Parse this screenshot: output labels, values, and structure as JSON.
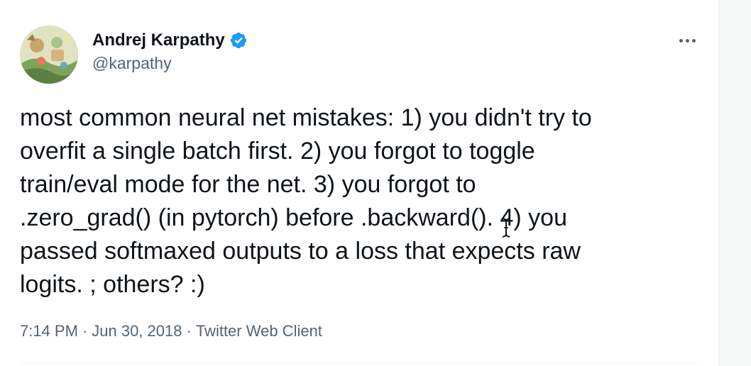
{
  "author": {
    "display_name": "Andrej Karpathy",
    "handle": "@karpathy",
    "verified": true,
    "avatar_icon": "avatar-illustration"
  },
  "tweet": {
    "text": "most common neural net mistakes: 1) you didn't try to\noverfit a single batch first. 2) you forgot to toggle\ntrain/eval mode for the net. 3) you forgot to\n.zero_grad() (in pytorch) before .backward(). 4) you\npassed softmaxed outputs to a loss that expects raw\nlogits. ; others? :)"
  },
  "meta": {
    "time": "7:14 PM",
    "separator": "·",
    "date": "Jun 30, 2018",
    "client": "Twitter Web Client"
  },
  "icons": {
    "verified": "verified-badge-icon",
    "more": "more-options-icon",
    "cursor": "text-cursor-icon"
  },
  "colors": {
    "text": "#0f1419",
    "secondary": "#536471",
    "verified": "#1d9bf0"
  }
}
